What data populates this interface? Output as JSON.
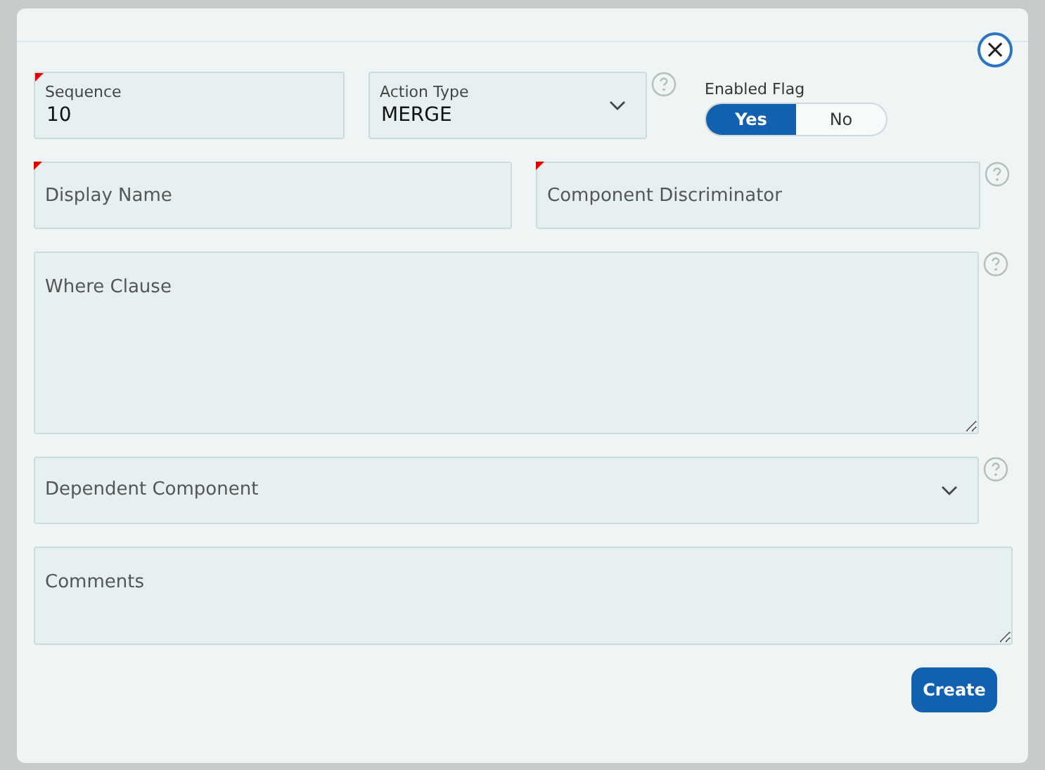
{
  "close_button": "×",
  "rows": [
    {
      "fields": [
        {
          "kind": "text",
          "label": "Sequence",
          "value": "10",
          "required": true,
          "help": false
        },
        {
          "kind": "select",
          "label": "Action Type",
          "value": "MERGE",
          "required": false,
          "help": true
        },
        {
          "kind": "toggle",
          "label": "Enabled Flag",
          "options": [
            {
              "label": "Yes",
              "selected": true
            },
            {
              "label": "No",
              "selected": false
            }
          ]
        }
      ]
    },
    {
      "fields": [
        {
          "kind": "text",
          "placeholder": "Display Name",
          "required": true,
          "help": false
        },
        {
          "kind": "text",
          "placeholder": "Component Discriminator",
          "required": true,
          "help": true
        }
      ]
    },
    {
      "fields": [
        {
          "kind": "textarea",
          "placeholder": "Where Clause",
          "required": false,
          "help": true
        }
      ]
    },
    {
      "fields": [
        {
          "kind": "select",
          "placeholder": "Dependent Component",
          "required": false,
          "help": true
        }
      ]
    },
    {
      "fields": [
        {
          "kind": "comments",
          "placeholder": "Comments",
          "required": false,
          "help": false
        }
      ]
    }
  ],
  "create_button": "Create"
}
